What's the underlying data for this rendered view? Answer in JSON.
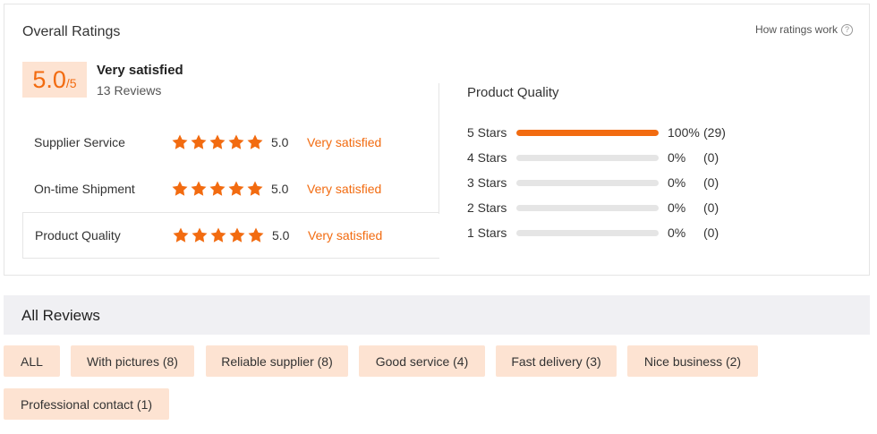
{
  "overall": {
    "title": "Overall Ratings",
    "how_link": "How ratings work",
    "score": "5.0",
    "score_max": "/5",
    "satisfaction": "Very satisfied",
    "reviews": "13 Reviews",
    "accent_color": "#f26b10",
    "categories": [
      {
        "name": "Supplier Service",
        "score": "5.0",
        "level": "Very satisfied",
        "stars": 5
      },
      {
        "name": "On-time Shipment",
        "score": "5.0",
        "level": "Very satisfied",
        "stars": 5
      },
      {
        "name": "Product Quality",
        "score": "5.0",
        "level": "Very satisfied",
        "stars": 5
      }
    ]
  },
  "product_quality": {
    "title": "Product Quality",
    "rows": [
      {
        "label": "5 Stars",
        "pct_text": "100%",
        "count": "(29)",
        "fill": 1.0
      },
      {
        "label": "4 Stars",
        "pct_text": "0%",
        "count": "(0)",
        "fill": 0
      },
      {
        "label": "3 Stars",
        "pct_text": "0%",
        "count": "(0)",
        "fill": 0
      },
      {
        "label": "2 Stars",
        "pct_text": "0%",
        "count": "(0)",
        "fill": 0
      },
      {
        "label": "1 Stars",
        "pct_text": "0%",
        "count": "(0)",
        "fill": 0
      }
    ]
  },
  "all_reviews": {
    "title": "All Reviews",
    "tags": [
      "ALL",
      "With pictures (8)",
      "Reliable supplier (8)",
      "Good service (4)",
      "Fast delivery (3)",
      "Nice business (2)",
      "Professional contact (1)"
    ]
  }
}
